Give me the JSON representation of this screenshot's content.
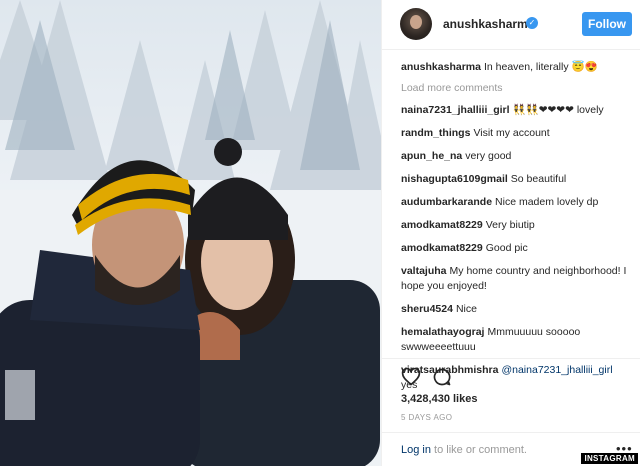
{
  "post": {
    "username": "anushkasharma",
    "follow_label": "Follow",
    "caption_user": "anushkasharma",
    "caption_text": "In heaven, literally 😇😍",
    "load_more": "Load more comments",
    "likes": "3,428,430 likes",
    "time": "5 DAYS AGO",
    "login_link": "Log in",
    "login_rest": " to like or comment.",
    "more_options": "•••",
    "watermark": "INSTAGRAM"
  },
  "comments": [
    {
      "user": "naina7231_jhalliii_girl",
      "text": "👯👯❤❤❤❤ lovely"
    },
    {
      "user": "randm_things",
      "text": "Visit my account"
    },
    {
      "user": "apun_he_na",
      "text": "very good"
    },
    {
      "user": "nishagupta6109gmail",
      "text": "So beautiful"
    },
    {
      "user": "audumbarkarande",
      "text": "Nice madem lovely dp"
    },
    {
      "user": "amodkamat8229",
      "text": "Very biutip"
    },
    {
      "user": "amodkamat8229",
      "text": "Good pic"
    },
    {
      "user": "valtajuha",
      "text": "My home country and neighborhood! I hope you enjoyed!"
    },
    {
      "user": "sheru4524",
      "text": "Nice"
    },
    {
      "user": "hemalathayograj",
      "text": "Mmmuuuuu sooooo swwweeeettuuu"
    },
    {
      "user": "viratsaurabhmishra",
      "mention": "@naina7231_jhalliii_girl",
      "text": "yes"
    }
  ],
  "colors": {
    "accent": "#3897f0",
    "link": "#003569",
    "muted": "#999999"
  },
  "icons": {
    "like": "heart-icon",
    "comment": "comment-icon",
    "verified": "verified-badge-icon"
  }
}
